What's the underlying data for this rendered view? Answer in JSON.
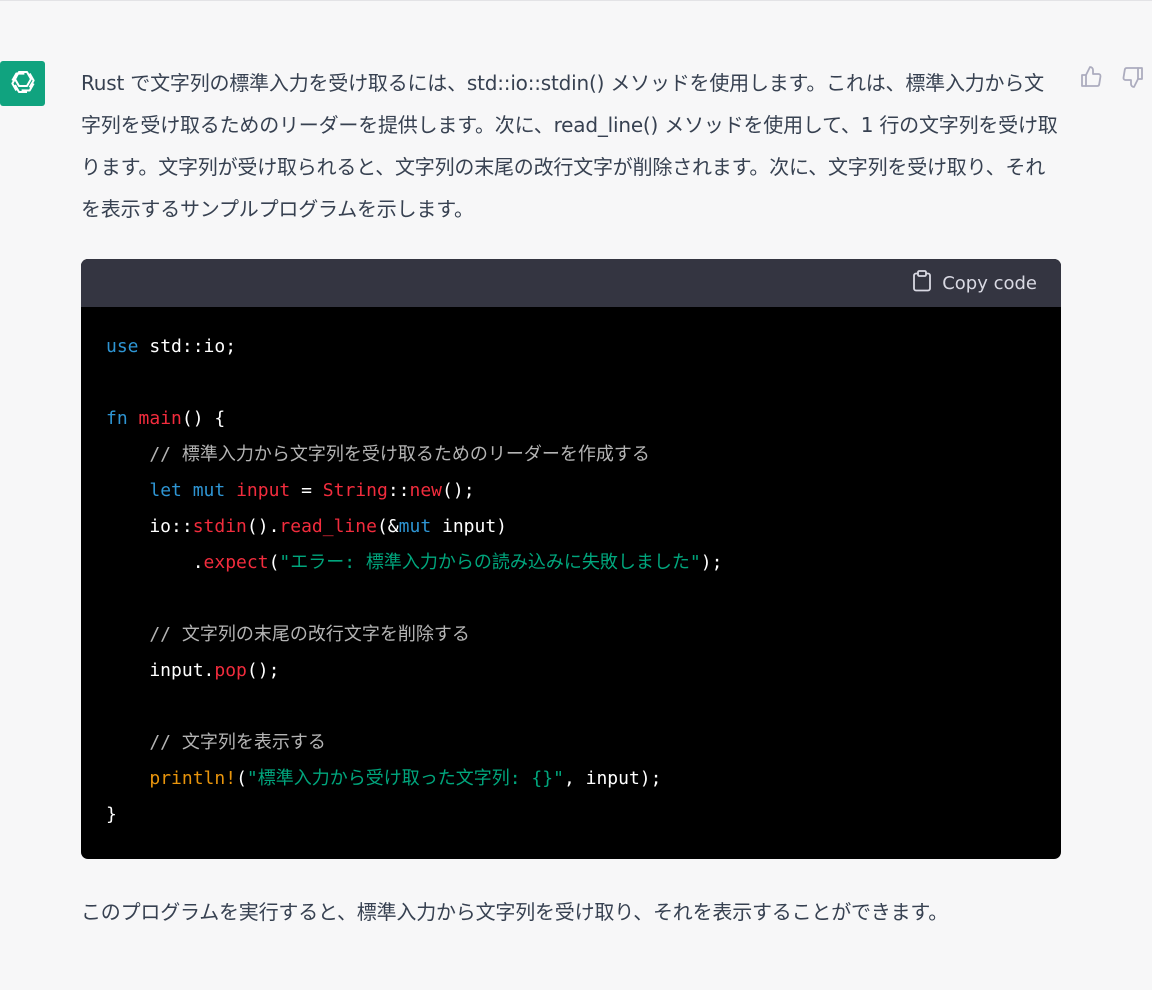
{
  "message": {
    "paragraph": "Rust で文字列の標準入力を受け取るには、std::io::stdin() メソッドを使用します。これは、標準入力から文字列を受け取るためのリーダーを提供します。次に、read_line() メソッドを使用して、1 行の文字列を受け取ります。文字列が受け取られると、文字列の末尾の改行文字が削除されます。次に、文字列を受け取り、それを表示するサンプルプログラムを示します。",
    "footer": "このプログラムを実行すると、標準入力から文字列を受け取り、それを表示することができます。"
  },
  "codeblock": {
    "copy_label": "Copy code",
    "lines": [
      {
        "tokens": [
          {
            "t": "use",
            "c": "kw"
          },
          {
            "t": " std::io;",
            "c": "plain"
          }
        ]
      },
      {
        "tokens": []
      },
      {
        "tokens": [
          {
            "t": "fn",
            "c": "kw"
          },
          {
            "t": " ",
            "c": "plain"
          },
          {
            "t": "main",
            "c": "fnname"
          },
          {
            "t": "() {",
            "c": "plain"
          }
        ]
      },
      {
        "tokens": [
          {
            "t": "    // 標準入力から文字列を受け取るためのリーダーを作成する",
            "c": "cm"
          }
        ]
      },
      {
        "tokens": [
          {
            "t": "    ",
            "c": "plain"
          },
          {
            "t": "let",
            "c": "kw"
          },
          {
            "t": " ",
            "c": "plain"
          },
          {
            "t": "mut",
            "c": "kw"
          },
          {
            "t": " ",
            "c": "plain"
          },
          {
            "t": "input",
            "c": "fnname"
          },
          {
            "t": " = ",
            "c": "plain"
          },
          {
            "t": "String",
            "c": "ty"
          },
          {
            "t": "::",
            "c": "plain"
          },
          {
            "t": "new",
            "c": "fnname"
          },
          {
            "t": "();",
            "c": "plain"
          }
        ]
      },
      {
        "tokens": [
          {
            "t": "    io::",
            "c": "plain"
          },
          {
            "t": "stdin",
            "c": "fnname"
          },
          {
            "t": "().",
            "c": "plain"
          },
          {
            "t": "read_line",
            "c": "fnname"
          },
          {
            "t": "(&",
            "c": "plain"
          },
          {
            "t": "mut",
            "c": "kw"
          },
          {
            "t": " input)",
            "c": "plain"
          }
        ]
      },
      {
        "tokens": [
          {
            "t": "        .",
            "c": "plain"
          },
          {
            "t": "expect",
            "c": "fnname"
          },
          {
            "t": "(",
            "c": "plain"
          },
          {
            "t": "\"エラー: 標準入力からの読み込みに失敗しました\"",
            "c": "str"
          },
          {
            "t": ");",
            "c": "plain"
          }
        ]
      },
      {
        "tokens": []
      },
      {
        "tokens": [
          {
            "t": "    // 文字列の末尾の改行文字を削除する",
            "c": "cm"
          }
        ]
      },
      {
        "tokens": [
          {
            "t": "    input.",
            "c": "plain"
          },
          {
            "t": "pop",
            "c": "fnname"
          },
          {
            "t": "();",
            "c": "plain"
          }
        ]
      },
      {
        "tokens": []
      },
      {
        "tokens": [
          {
            "t": "    // 文字列を表示する",
            "c": "cm"
          }
        ]
      },
      {
        "tokens": [
          {
            "t": "    ",
            "c": "plain"
          },
          {
            "t": "println!",
            "c": "macro-yellow"
          },
          {
            "t": "(",
            "c": "plain"
          },
          {
            "t": "\"標準入力から受け取った文字列: {}\"",
            "c": "str"
          },
          {
            "t": ", input);",
            "c": "plain"
          }
        ]
      },
      {
        "tokens": [
          {
            "t": "}",
            "c": "plain"
          }
        ]
      }
    ]
  },
  "colors": {
    "avatar_bg": "#10a37f",
    "page_bg": "#f7f7f8",
    "code_bg": "#000000",
    "code_header_bg": "#343541"
  },
  "icons": {
    "avatar": "openai-logo-icon",
    "like": "thumbs-up-icon",
    "dislike": "thumbs-down-icon",
    "copy": "clipboard-icon"
  }
}
